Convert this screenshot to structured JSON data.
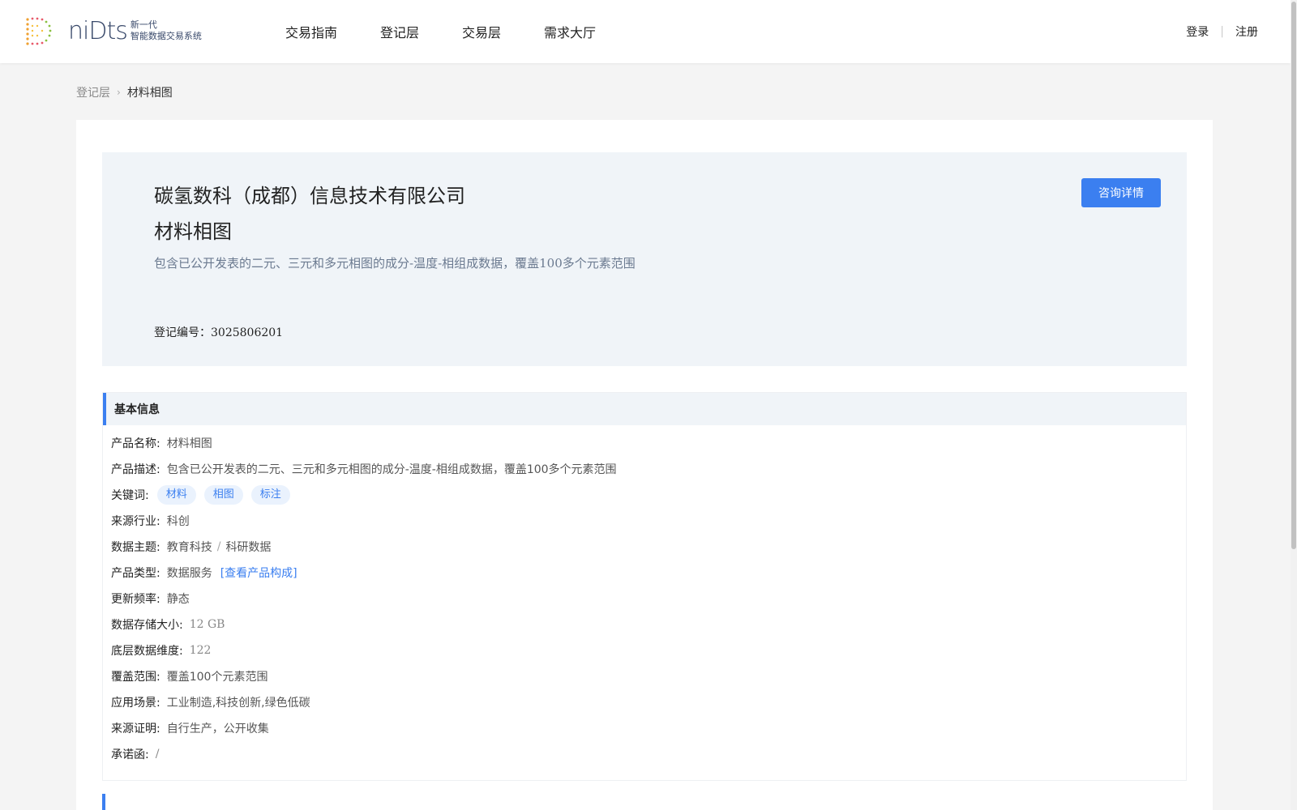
{
  "brand": {
    "wordmark": "niDts",
    "subtitle_line1": "新一代",
    "subtitle_line2": "智能数据交易系统"
  },
  "nav": {
    "items": [
      {
        "label": "交易指南"
      },
      {
        "label": "登记层"
      },
      {
        "label": "交易层"
      },
      {
        "label": "需求大厅"
      }
    ]
  },
  "auth": {
    "login": "登录",
    "separator": "|",
    "register": "注册"
  },
  "breadcrumb": {
    "parent": "登记层",
    "separator": "›",
    "current": "材料相图"
  },
  "hero": {
    "company": "碳氢数科（成都）信息技术有限公司",
    "product": "材料相图",
    "description": "包含已公开发表的二元、三元和多元相图的成分-温度-相组成数据，覆盖100多个元素范围",
    "reg_label": "登记编号：",
    "reg_number": "3025806201",
    "consult_button": "咨询详情"
  },
  "basic_info": {
    "title": "基本信息",
    "product_name_label": "产品名称:",
    "product_name": "材料相图",
    "product_desc_label": "产品描述:",
    "product_desc": "包含已公开发表的二元、三元和多元相图的成分-温度-相组成数据，覆盖100多个元素范围",
    "keywords_label": "关键词:",
    "keywords": [
      "材料",
      "相图",
      "标注"
    ],
    "industry_label": "来源行业:",
    "industry": "科创",
    "theme_label": "数据主题:",
    "theme_1": "教育科技",
    "theme_sep": "/",
    "theme_2": "科研数据",
    "type_label": "产品类型:",
    "type": "数据服务",
    "type_link": "[查看产品构成]",
    "freq_label": "更新频率:",
    "freq": "静态",
    "size_label": "数据存储大小:",
    "size": "12 GB",
    "dim_label": "底层数据维度:",
    "dim": "122",
    "coverage_label": "覆盖范围:",
    "coverage": "覆盖100个元素范围",
    "scenario_label": "应用场景:",
    "scenario": "工业制造,科技创新,绿色低碳",
    "proof_label": "来源证明:",
    "proof": "自行生产，公开收集",
    "commit_label": "承诺函:",
    "commit": "/"
  },
  "colors": {
    "accent": "#3b7ff0",
    "hero_bg": "#f0f4f8",
    "page_bg": "#f4f4f4"
  }
}
